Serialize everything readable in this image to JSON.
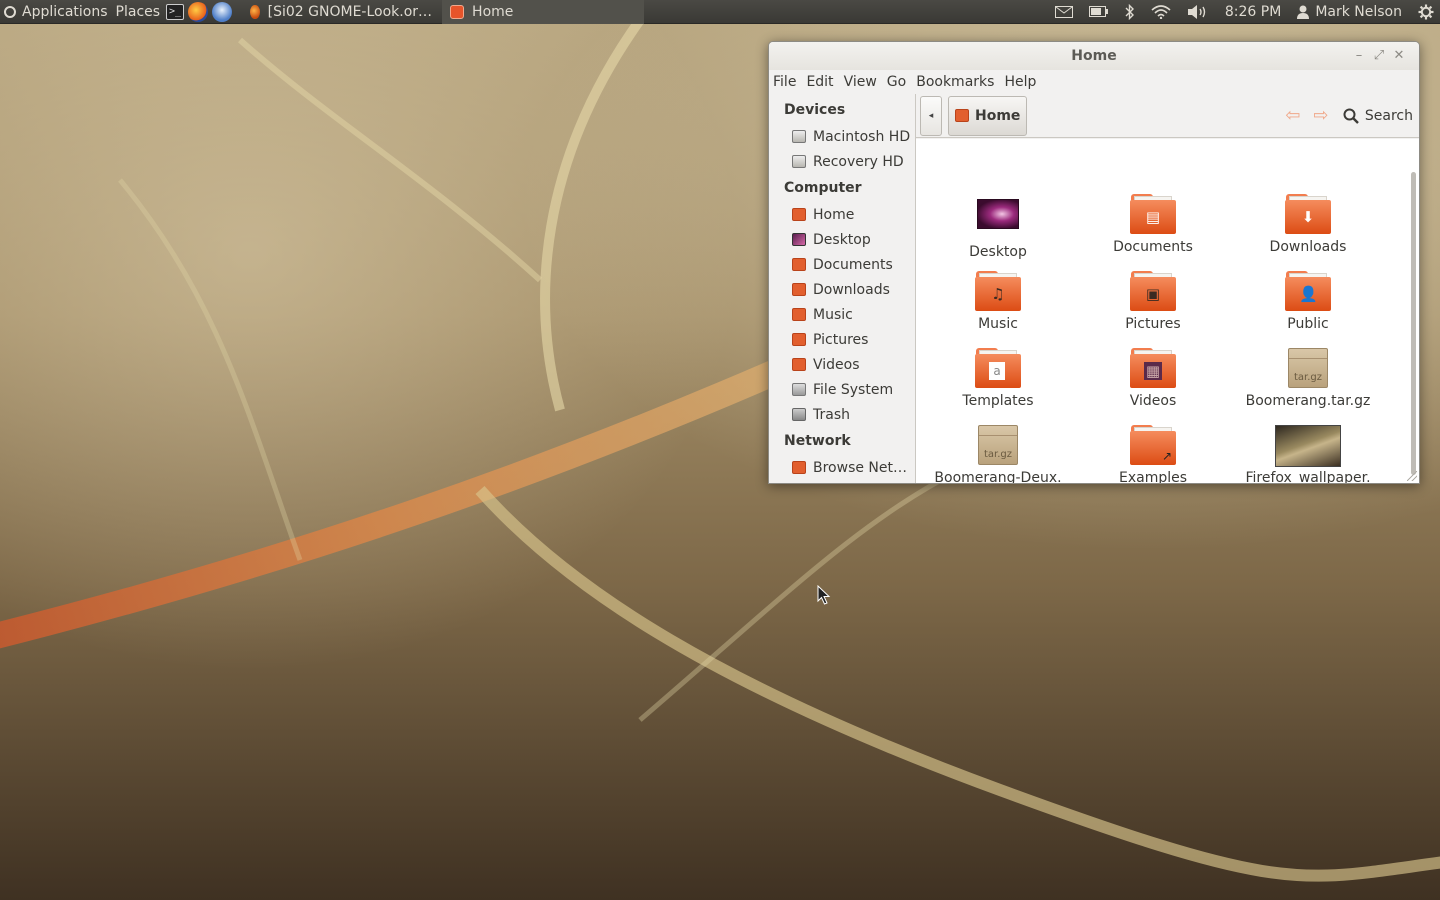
{
  "top_panel": {
    "applications_label": "Applications",
    "places_label": "Places",
    "launchers": [
      "terminal-icon",
      "firefox-icon",
      "thunderbird-icon"
    ],
    "tasks": [
      {
        "label": "[Si02 GNOME-Look.or…",
        "icon": "firefox-icon",
        "active": false
      },
      {
        "label": "Home",
        "icon": "home-folder-icon",
        "active": true
      }
    ],
    "tray_icons": [
      "mail-icon",
      "battery-icon",
      "bluetooth-icon",
      "wifi-icon",
      "volume-icon"
    ],
    "clock": "8:26 PM",
    "user_name": "Mark Nelson",
    "session_icon": "power-gear-icon"
  },
  "window": {
    "title": "Home",
    "controls": [
      "minimize-icon",
      "maximize-icon",
      "close-icon"
    ],
    "menu": [
      "File",
      "Edit",
      "View",
      "Go",
      "Bookmarks",
      "Help"
    ],
    "sidebar": {
      "devices_heading": "Devices",
      "devices": [
        "Macintosh HD",
        "Recovery HD"
      ],
      "computer_heading": "Computer",
      "computer": [
        "Home",
        "Desktop",
        "Documents",
        "Downloads",
        "Music",
        "Pictures",
        "Videos",
        "File System",
        "Trash"
      ],
      "network_heading": "Network",
      "network": [
        "Browse Net…"
      ]
    },
    "location": {
      "back_glyph": "◂",
      "current": "Home",
      "back_arrow": "⇦",
      "forward_arrow": "⇨",
      "search_label": "Search"
    },
    "files": [
      {
        "name": "Desktop",
        "kind": "desktop"
      },
      {
        "name": "Documents",
        "kind": "folder-documents"
      },
      {
        "name": "Downloads",
        "kind": "folder-downloads"
      },
      {
        "name": "Music",
        "kind": "folder-music"
      },
      {
        "name": "Pictures",
        "kind": "folder-pictures"
      },
      {
        "name": "Public",
        "kind": "folder-public"
      },
      {
        "name": "Templates",
        "kind": "folder-templates"
      },
      {
        "name": "Videos",
        "kind": "folder-videos"
      },
      {
        "name": "Boomerang.tar.gz",
        "kind": "archive"
      },
      {
        "name": "Boomerang-Deux.\ntar.gz",
        "kind": "archive"
      },
      {
        "name": "Examples",
        "kind": "folder-link"
      },
      {
        "name": "Firefox_wallpaper.\npng",
        "kind": "image"
      }
    ],
    "archive_label": "tar.gz"
  },
  "colors": {
    "panel": "#3c3b37",
    "accent_orange": "#e25f2e",
    "window_bg": "#f2f1f0"
  }
}
